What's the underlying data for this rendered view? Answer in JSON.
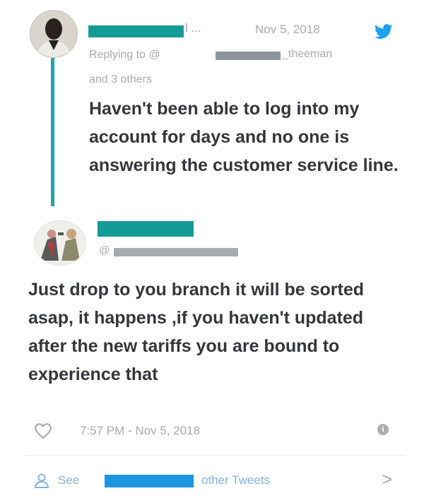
{
  "reply_tweet": {
    "name_suffix": "l ...",
    "date": "Nov 5, 2018",
    "replying_prefix": "Replying to @",
    "replying_handle_suffix": "_theeman",
    "replying_others": "and 3 others",
    "text": "Haven't been able to log into my account for days and no one is answering the customer service line."
  },
  "response_tweet": {
    "handle_prefix": "@",
    "text": "Just drop to you branch it will be sorted asap, it happens ,if you haven't updated after the new tariffs you are bound to experience that",
    "timestamp": "7:57 PM - Nov 5, 2018"
  },
  "see_others": {
    "prefix": "See",
    "suffix": "other Tweets",
    "chevron": ">"
  },
  "icons": [
    "twitter-bird-icon",
    "heart-icon",
    "info-icon",
    "person-icon",
    "chevron-right-icon"
  ],
  "colors": {
    "redaction_teal": "#159b96",
    "thread_line": "#1da5a7",
    "twitter_blue": "#1da1f2",
    "muted_text": "#a6abb0"
  }
}
